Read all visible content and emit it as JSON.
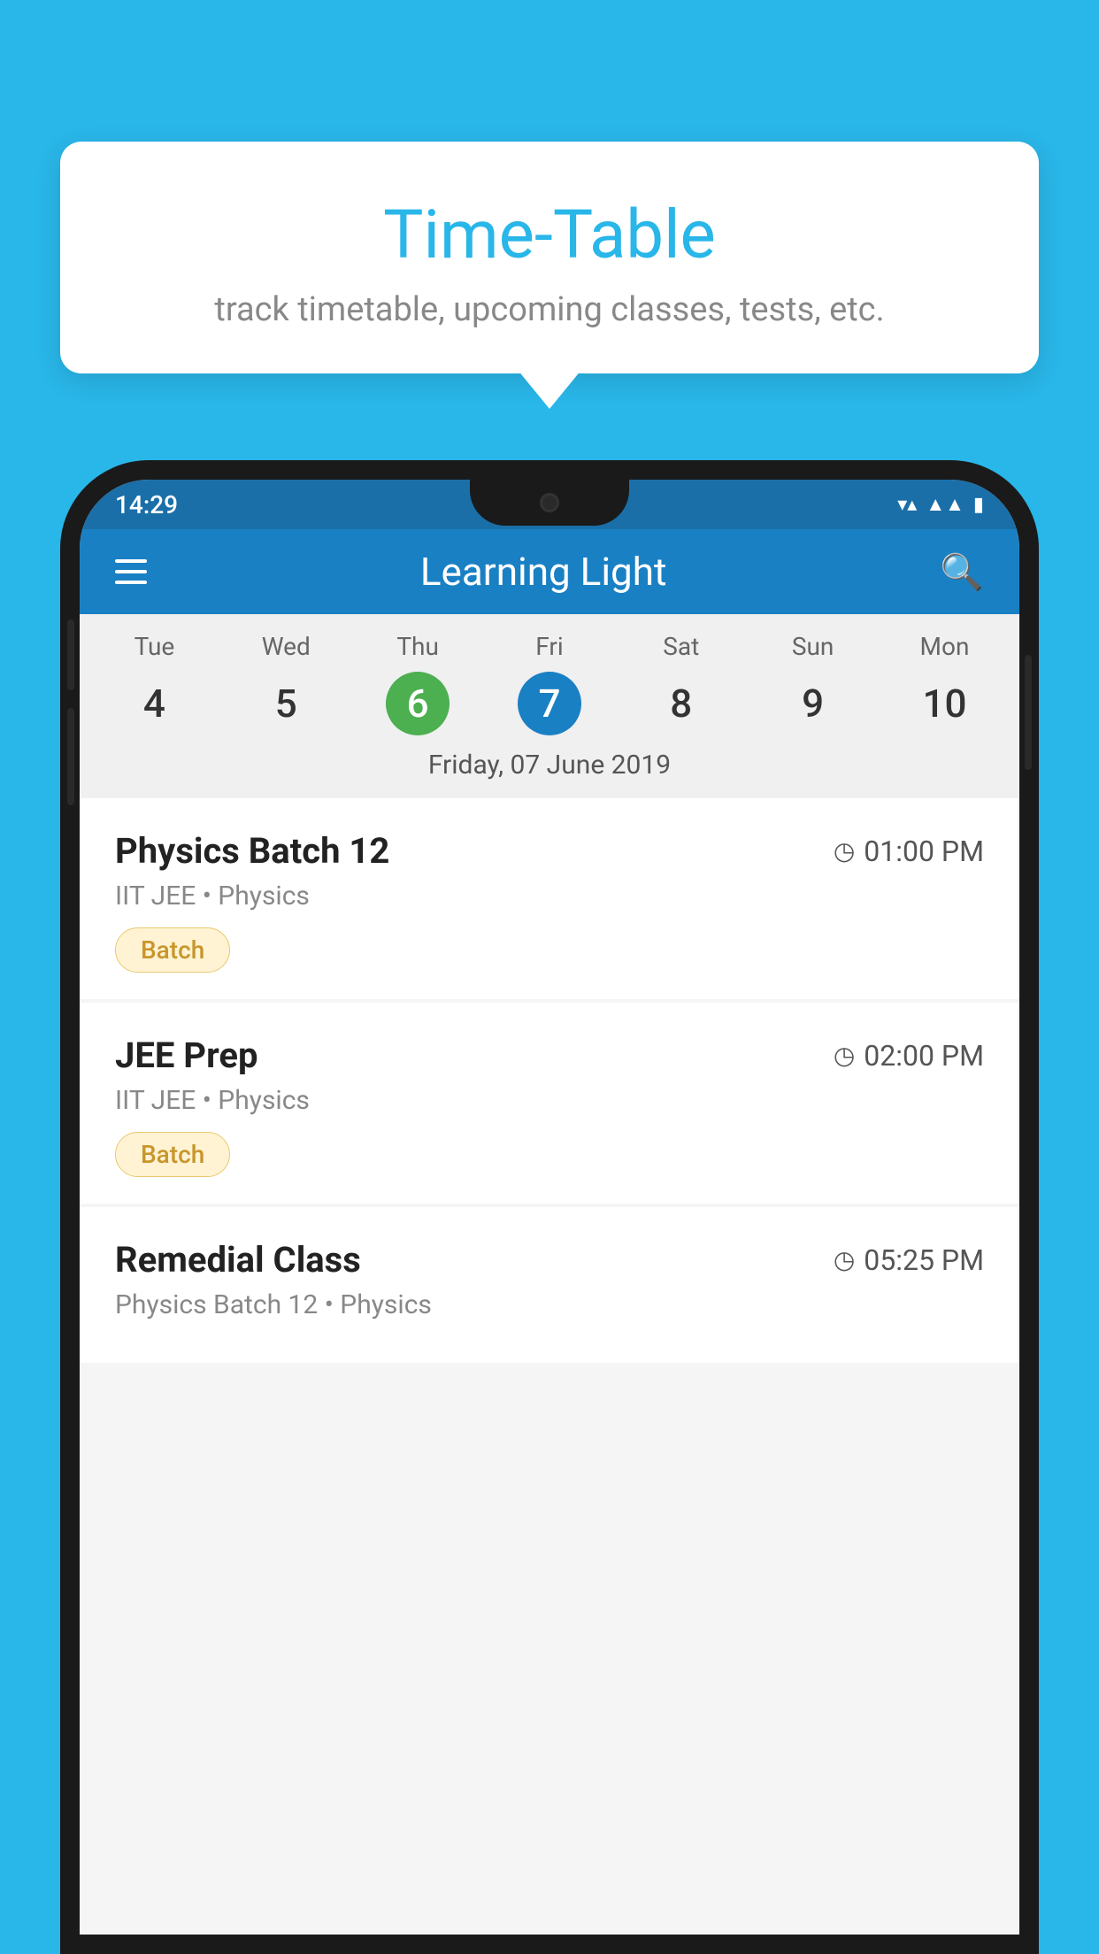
{
  "background_color": "#29b6e8",
  "tooltip": {
    "title": "Time-Table",
    "subtitle": "track timetable, upcoming classes, tests, etc."
  },
  "phone": {
    "status_bar": {
      "time": "14:29"
    },
    "app_bar": {
      "title": "Learning Light"
    },
    "calendar": {
      "days": [
        {
          "name": "Tue",
          "num": "4",
          "state": "normal"
        },
        {
          "name": "Wed",
          "num": "5",
          "state": "normal"
        },
        {
          "name": "Thu",
          "num": "6",
          "state": "today"
        },
        {
          "name": "Fri",
          "num": "7",
          "state": "selected"
        },
        {
          "name": "Sat",
          "num": "8",
          "state": "normal"
        },
        {
          "name": "Sun",
          "num": "9",
          "state": "normal"
        },
        {
          "name": "Mon",
          "num": "10",
          "state": "normal"
        }
      ],
      "selected_date_label": "Friday, 07 June 2019"
    },
    "schedule": [
      {
        "title": "Physics Batch 12",
        "time": "01:00 PM",
        "subtitle": "IIT JEE • Physics",
        "badge": "Batch"
      },
      {
        "title": "JEE Prep",
        "time": "02:00 PM",
        "subtitle": "IIT JEE • Physics",
        "badge": "Batch"
      },
      {
        "title": "Remedial Class",
        "time": "05:25 PM",
        "subtitle": "Physics Batch 12 • Physics",
        "badge": null
      }
    ]
  }
}
